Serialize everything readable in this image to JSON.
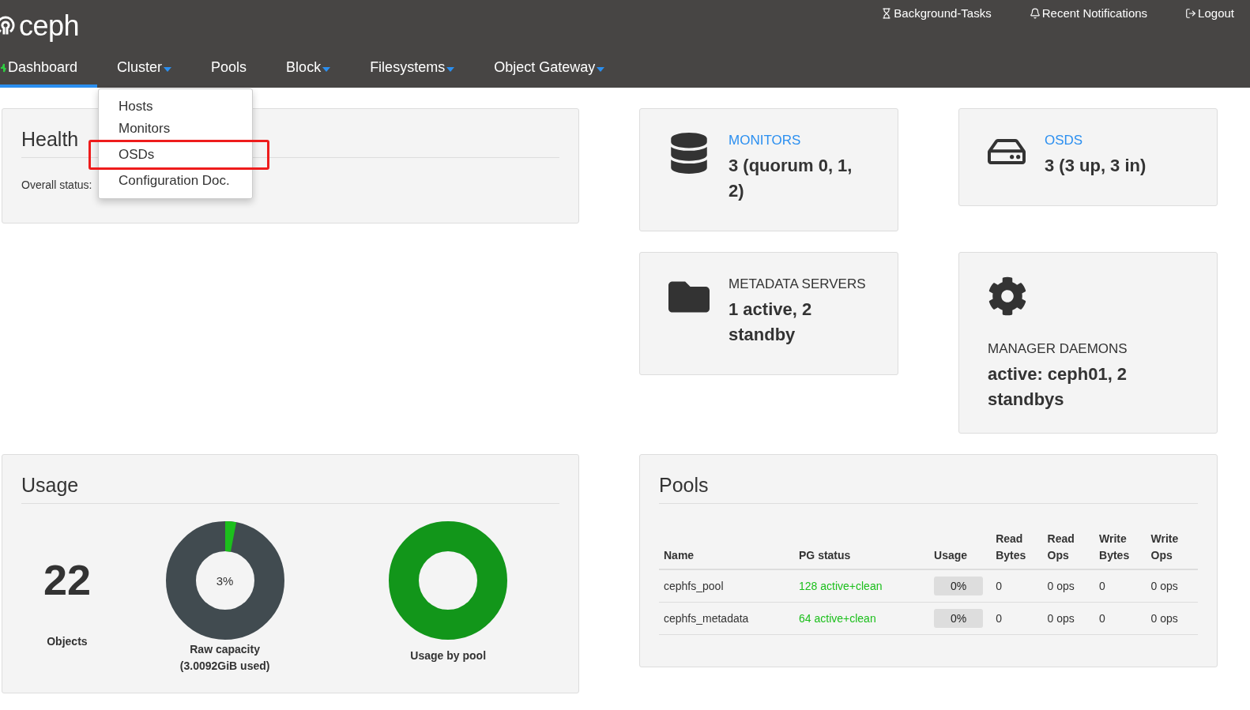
{
  "header": {
    "logo": "ceph",
    "utilities": [
      {
        "kind": "tasks",
        "label": "Background-Tasks"
      },
      {
        "kind": "notifications",
        "label": "Recent Notifications"
      },
      {
        "kind": "logout",
        "label": "Logout"
      }
    ]
  },
  "nav": [
    {
      "label": "Dashboard",
      "selected": true,
      "dropdown": false,
      "icon": true
    },
    {
      "label": "Cluster",
      "selected": false,
      "dropdown": true,
      "icon": false
    },
    {
      "label": "Pools",
      "selected": false,
      "dropdown": false,
      "icon": false
    },
    {
      "label": "Block",
      "selected": false,
      "dropdown": true,
      "icon": false
    },
    {
      "label": "Filesystems",
      "selected": false,
      "dropdown": true,
      "icon": false
    },
    {
      "label": "Object Gateway",
      "selected": false,
      "dropdown": true,
      "icon": false
    }
  ],
  "cluster_menu": {
    "items": [
      {
        "label": "Hosts",
        "highlighted": false
      },
      {
        "label": "Monitors",
        "highlighted": false
      },
      {
        "label": "OSDs",
        "highlighted": true
      },
      {
        "label": "Configuration Doc.",
        "highlighted": false
      }
    ]
  },
  "health": {
    "title": "Health",
    "status_label": "Overall status:"
  },
  "info_cards": [
    {
      "kind": "monitors",
      "title": "MONITORS",
      "link": true,
      "value": "3 (quorum 0, 1, 2)"
    },
    {
      "kind": "osds",
      "title": "OSDS",
      "link": true,
      "value": "3 (3 up, 3 in)"
    },
    {
      "kind": "mds",
      "title": "METADATA SERVERS",
      "link": false,
      "value": "1 active, 2 standby"
    },
    {
      "kind": "mgr",
      "title": "MANAGER DAEMONS",
      "link": false,
      "value": "active: ceph01, 2 standbys"
    }
  ],
  "usage": {
    "title": "Usage",
    "objects": {
      "count": "22",
      "label": "Objects"
    },
    "raw_capacity": {
      "percent": "3%",
      "level": 0.03,
      "label": "Raw capacity",
      "detail": "(3.0092GiB used)"
    },
    "by_pool": {
      "label": "Usage by pool"
    }
  },
  "pools": {
    "title": "Pools",
    "columns": [
      "Name",
      "PG status",
      "Usage",
      "Read Bytes",
      "Read Ops",
      "Write Bytes",
      "Write Ops"
    ],
    "rows": [
      {
        "name": "cephfs_pool",
        "pg_status": "128 active+clean",
        "usage": "0%",
        "level": 0,
        "read_bytes": "0",
        "read_ops": "0 ops",
        "write_bytes": "0",
        "write_ops": "0 ops"
      },
      {
        "name": "cephfs_metadata",
        "pg_status": "64 active+clean",
        "usage": "0%",
        "level": 0,
        "read_bytes": "0",
        "read_ops": "0 ops",
        "write_bytes": "0",
        "write_ops": "0 ops"
      }
    ]
  }
}
